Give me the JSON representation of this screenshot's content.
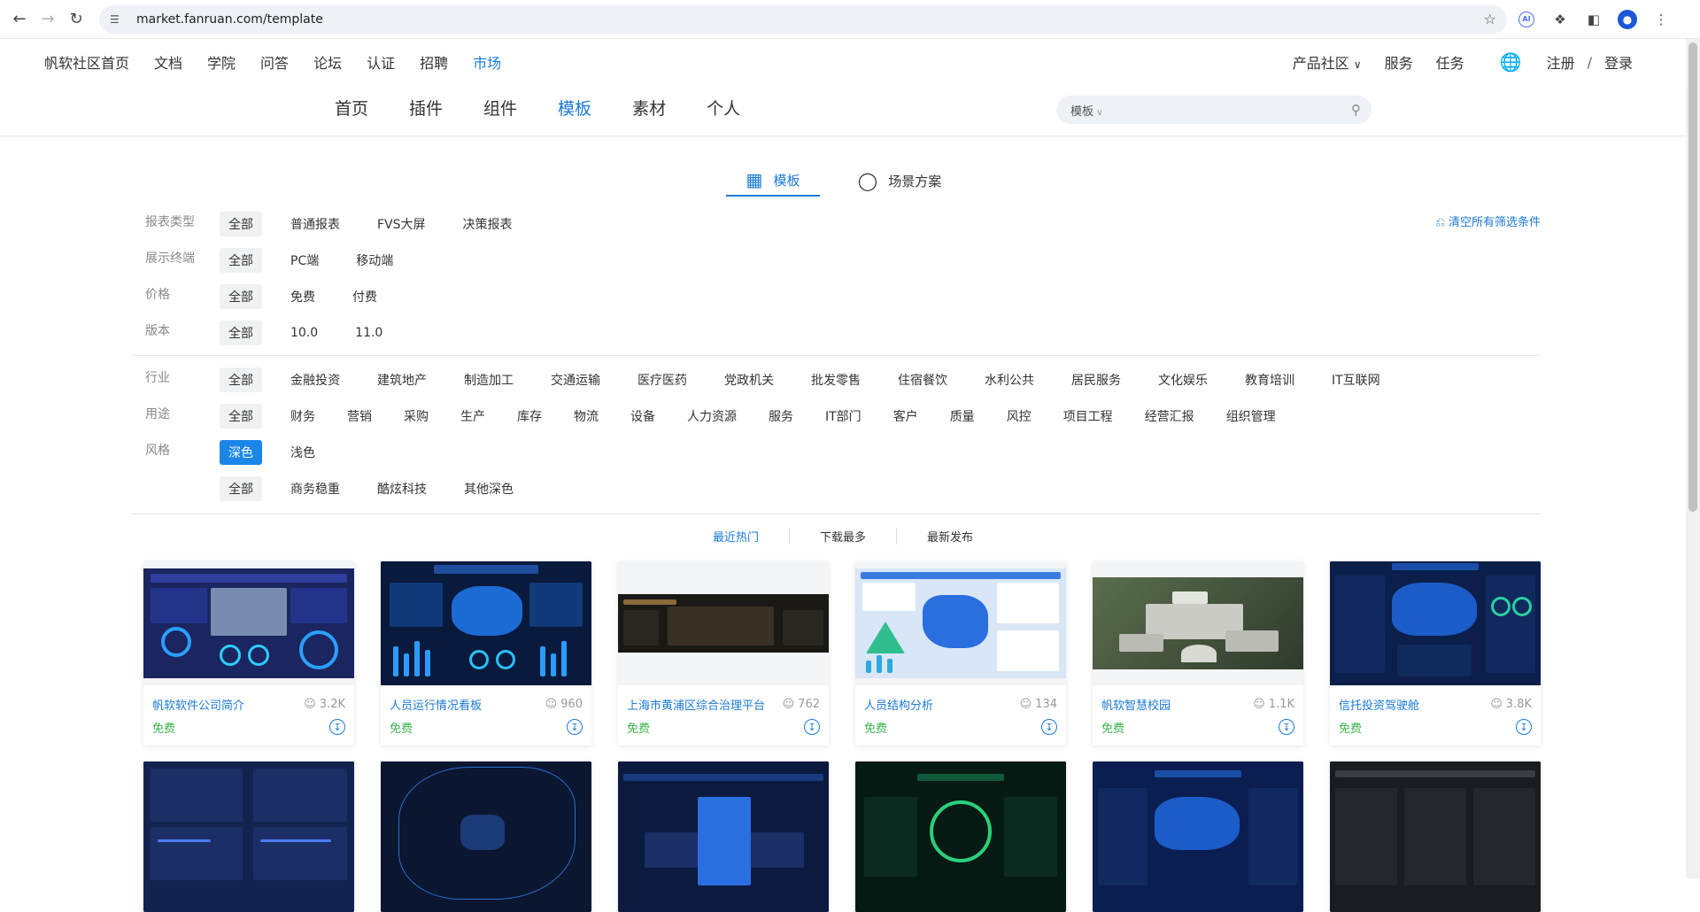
{
  "browser": {
    "url": "market.fanruan.com/template"
  },
  "topnav": {
    "left": [
      {
        "label": "帆软社区首页"
      },
      {
        "label": "文档"
      },
      {
        "label": "学院"
      },
      {
        "label": "问答"
      },
      {
        "label": "论坛"
      },
      {
        "label": "认证"
      },
      {
        "label": "招聘"
      },
      {
        "label": "市场",
        "active": true
      }
    ],
    "product": "产品社区",
    "service": "服务",
    "task": "任务",
    "register": "注册",
    "slash": "/",
    "login": "登录"
  },
  "subnav": {
    "tabs": [
      "首页",
      "插件",
      "组件",
      "模板",
      "素材",
      "个人"
    ],
    "active_tab": "模板",
    "search_scope": "模板"
  },
  "content_tabs": [
    "模板",
    "场景方案"
  ],
  "filters": {
    "clear_label": "清空所有筛选条件",
    "report_type": {
      "label": "报表类型",
      "options": [
        "全部",
        "普通报表",
        "FVS大屏",
        "决策报表"
      ]
    },
    "terminal": {
      "label": "展示终端",
      "options": [
        "全部",
        "PC端",
        "移动端"
      ]
    },
    "price": {
      "label": "价格",
      "options": [
        "全部",
        "免费",
        "付费"
      ]
    },
    "version": {
      "label": "版本",
      "options": [
        "全部",
        "10.0",
        "11.0"
      ]
    },
    "industry": {
      "label": "行业",
      "options": [
        "全部",
        "金融投资",
        "建筑地产",
        "制造加工",
        "交通运输",
        "医疗医药",
        "党政机关",
        "批发零售",
        "住宿餐饮",
        "水利公共",
        "居民服务",
        "文化娱乐",
        "教育培训",
        "IT互联网"
      ]
    },
    "usage": {
      "label": "用途",
      "options": [
        "全部",
        "财务",
        "营销",
        "采购",
        "生产",
        "库存",
        "物流",
        "设备",
        "人力资源",
        "服务",
        "IT部门",
        "客户",
        "质量",
        "风控",
        "项目工程",
        "经营汇报",
        "组织管理"
      ]
    },
    "style": {
      "label": "风格",
      "options": [
        "深色",
        "浅色"
      ]
    },
    "substyle": {
      "options": [
        "全部",
        "商务稳重",
        "酷炫科技",
        "其他深色"
      ]
    }
  },
  "sort_tabs": [
    "最近热门",
    "下载最多",
    "最新发布"
  ],
  "cards": [
    {
      "name": "帆软软件公司简介",
      "downloads": "3.2K",
      "price": "免费"
    },
    {
      "name": "人员运行情况看板",
      "downloads": "960",
      "price": "免费"
    },
    {
      "name": "上海市黄浦区综合治理平台",
      "downloads": "762",
      "price": "免费"
    },
    {
      "name": "人员结构分析",
      "downloads": "134",
      "price": "免费"
    },
    {
      "name": "帆软智慧校园",
      "downloads": "1.1K",
      "price": "免费"
    },
    {
      "name": "信托投资驾驶舱",
      "downloads": "3.8K",
      "price": "免费"
    }
  ],
  "colors": {
    "accent": "#1a7ad9",
    "free": "#3bb54a",
    "selected": "#1a86e8"
  }
}
